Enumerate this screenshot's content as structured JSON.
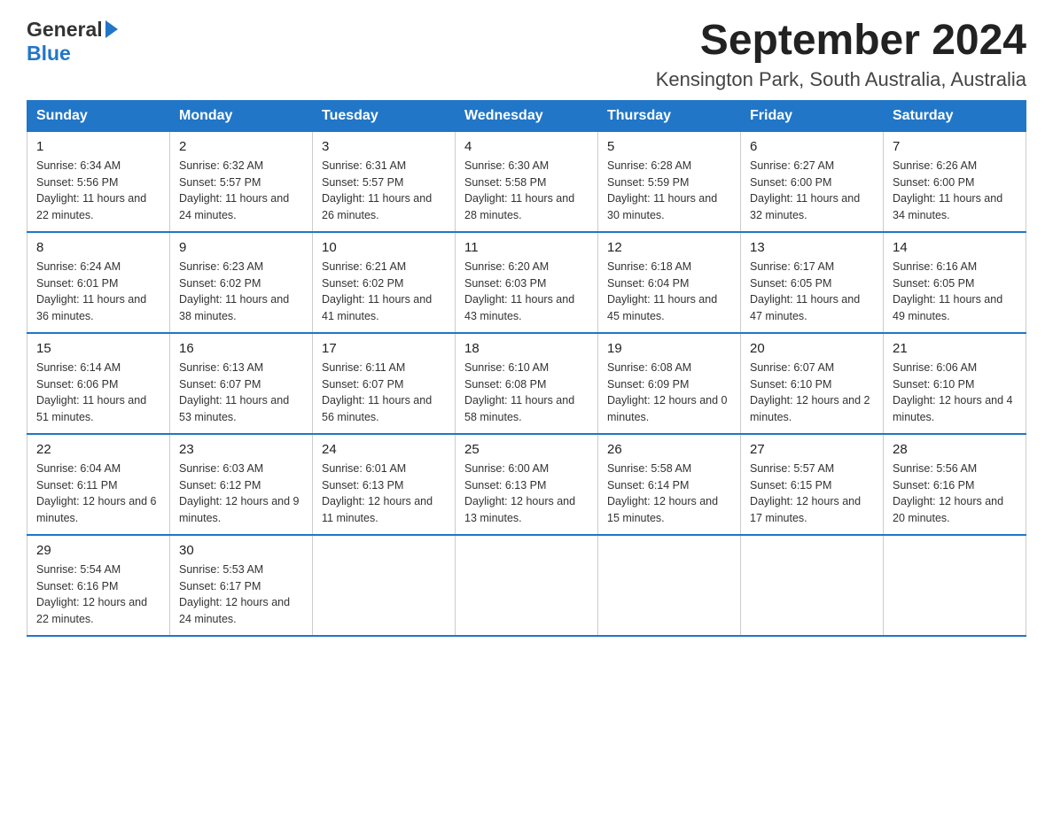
{
  "header": {
    "month_year": "September 2024",
    "location": "Kensington Park, South Australia, Australia",
    "logo_general": "General",
    "logo_blue": "Blue"
  },
  "columns": [
    "Sunday",
    "Monday",
    "Tuesday",
    "Wednesday",
    "Thursday",
    "Friday",
    "Saturday"
  ],
  "weeks": [
    [
      {
        "day": "1",
        "sunrise": "Sunrise: 6:34 AM",
        "sunset": "Sunset: 5:56 PM",
        "daylight": "Daylight: 11 hours and 22 minutes."
      },
      {
        "day": "2",
        "sunrise": "Sunrise: 6:32 AM",
        "sunset": "Sunset: 5:57 PM",
        "daylight": "Daylight: 11 hours and 24 minutes."
      },
      {
        "day": "3",
        "sunrise": "Sunrise: 6:31 AM",
        "sunset": "Sunset: 5:57 PM",
        "daylight": "Daylight: 11 hours and 26 minutes."
      },
      {
        "day": "4",
        "sunrise": "Sunrise: 6:30 AM",
        "sunset": "Sunset: 5:58 PM",
        "daylight": "Daylight: 11 hours and 28 minutes."
      },
      {
        "day": "5",
        "sunrise": "Sunrise: 6:28 AM",
        "sunset": "Sunset: 5:59 PM",
        "daylight": "Daylight: 11 hours and 30 minutes."
      },
      {
        "day": "6",
        "sunrise": "Sunrise: 6:27 AM",
        "sunset": "Sunset: 6:00 PM",
        "daylight": "Daylight: 11 hours and 32 minutes."
      },
      {
        "day": "7",
        "sunrise": "Sunrise: 6:26 AM",
        "sunset": "Sunset: 6:00 PM",
        "daylight": "Daylight: 11 hours and 34 minutes."
      }
    ],
    [
      {
        "day": "8",
        "sunrise": "Sunrise: 6:24 AM",
        "sunset": "Sunset: 6:01 PM",
        "daylight": "Daylight: 11 hours and 36 minutes."
      },
      {
        "day": "9",
        "sunrise": "Sunrise: 6:23 AM",
        "sunset": "Sunset: 6:02 PM",
        "daylight": "Daylight: 11 hours and 38 minutes."
      },
      {
        "day": "10",
        "sunrise": "Sunrise: 6:21 AM",
        "sunset": "Sunset: 6:02 PM",
        "daylight": "Daylight: 11 hours and 41 minutes."
      },
      {
        "day": "11",
        "sunrise": "Sunrise: 6:20 AM",
        "sunset": "Sunset: 6:03 PM",
        "daylight": "Daylight: 11 hours and 43 minutes."
      },
      {
        "day": "12",
        "sunrise": "Sunrise: 6:18 AM",
        "sunset": "Sunset: 6:04 PM",
        "daylight": "Daylight: 11 hours and 45 minutes."
      },
      {
        "day": "13",
        "sunrise": "Sunrise: 6:17 AM",
        "sunset": "Sunset: 6:05 PM",
        "daylight": "Daylight: 11 hours and 47 minutes."
      },
      {
        "day": "14",
        "sunrise": "Sunrise: 6:16 AM",
        "sunset": "Sunset: 6:05 PM",
        "daylight": "Daylight: 11 hours and 49 minutes."
      }
    ],
    [
      {
        "day": "15",
        "sunrise": "Sunrise: 6:14 AM",
        "sunset": "Sunset: 6:06 PM",
        "daylight": "Daylight: 11 hours and 51 minutes."
      },
      {
        "day": "16",
        "sunrise": "Sunrise: 6:13 AM",
        "sunset": "Sunset: 6:07 PM",
        "daylight": "Daylight: 11 hours and 53 minutes."
      },
      {
        "day": "17",
        "sunrise": "Sunrise: 6:11 AM",
        "sunset": "Sunset: 6:07 PM",
        "daylight": "Daylight: 11 hours and 56 minutes."
      },
      {
        "day": "18",
        "sunrise": "Sunrise: 6:10 AM",
        "sunset": "Sunset: 6:08 PM",
        "daylight": "Daylight: 11 hours and 58 minutes."
      },
      {
        "day": "19",
        "sunrise": "Sunrise: 6:08 AM",
        "sunset": "Sunset: 6:09 PM",
        "daylight": "Daylight: 12 hours and 0 minutes."
      },
      {
        "day": "20",
        "sunrise": "Sunrise: 6:07 AM",
        "sunset": "Sunset: 6:10 PM",
        "daylight": "Daylight: 12 hours and 2 minutes."
      },
      {
        "day": "21",
        "sunrise": "Sunrise: 6:06 AM",
        "sunset": "Sunset: 6:10 PM",
        "daylight": "Daylight: 12 hours and 4 minutes."
      }
    ],
    [
      {
        "day": "22",
        "sunrise": "Sunrise: 6:04 AM",
        "sunset": "Sunset: 6:11 PM",
        "daylight": "Daylight: 12 hours and 6 minutes."
      },
      {
        "day": "23",
        "sunrise": "Sunrise: 6:03 AM",
        "sunset": "Sunset: 6:12 PM",
        "daylight": "Daylight: 12 hours and 9 minutes."
      },
      {
        "day": "24",
        "sunrise": "Sunrise: 6:01 AM",
        "sunset": "Sunset: 6:13 PM",
        "daylight": "Daylight: 12 hours and 11 minutes."
      },
      {
        "day": "25",
        "sunrise": "Sunrise: 6:00 AM",
        "sunset": "Sunset: 6:13 PM",
        "daylight": "Daylight: 12 hours and 13 minutes."
      },
      {
        "day": "26",
        "sunrise": "Sunrise: 5:58 AM",
        "sunset": "Sunset: 6:14 PM",
        "daylight": "Daylight: 12 hours and 15 minutes."
      },
      {
        "day": "27",
        "sunrise": "Sunrise: 5:57 AM",
        "sunset": "Sunset: 6:15 PM",
        "daylight": "Daylight: 12 hours and 17 minutes."
      },
      {
        "day": "28",
        "sunrise": "Sunrise: 5:56 AM",
        "sunset": "Sunset: 6:16 PM",
        "daylight": "Daylight: 12 hours and 20 minutes."
      }
    ],
    [
      {
        "day": "29",
        "sunrise": "Sunrise: 5:54 AM",
        "sunset": "Sunset: 6:16 PM",
        "daylight": "Daylight: 12 hours and 22 minutes."
      },
      {
        "day": "30",
        "sunrise": "Sunrise: 5:53 AM",
        "sunset": "Sunset: 6:17 PM",
        "daylight": "Daylight: 12 hours and 24 minutes."
      },
      null,
      null,
      null,
      null,
      null
    ]
  ]
}
